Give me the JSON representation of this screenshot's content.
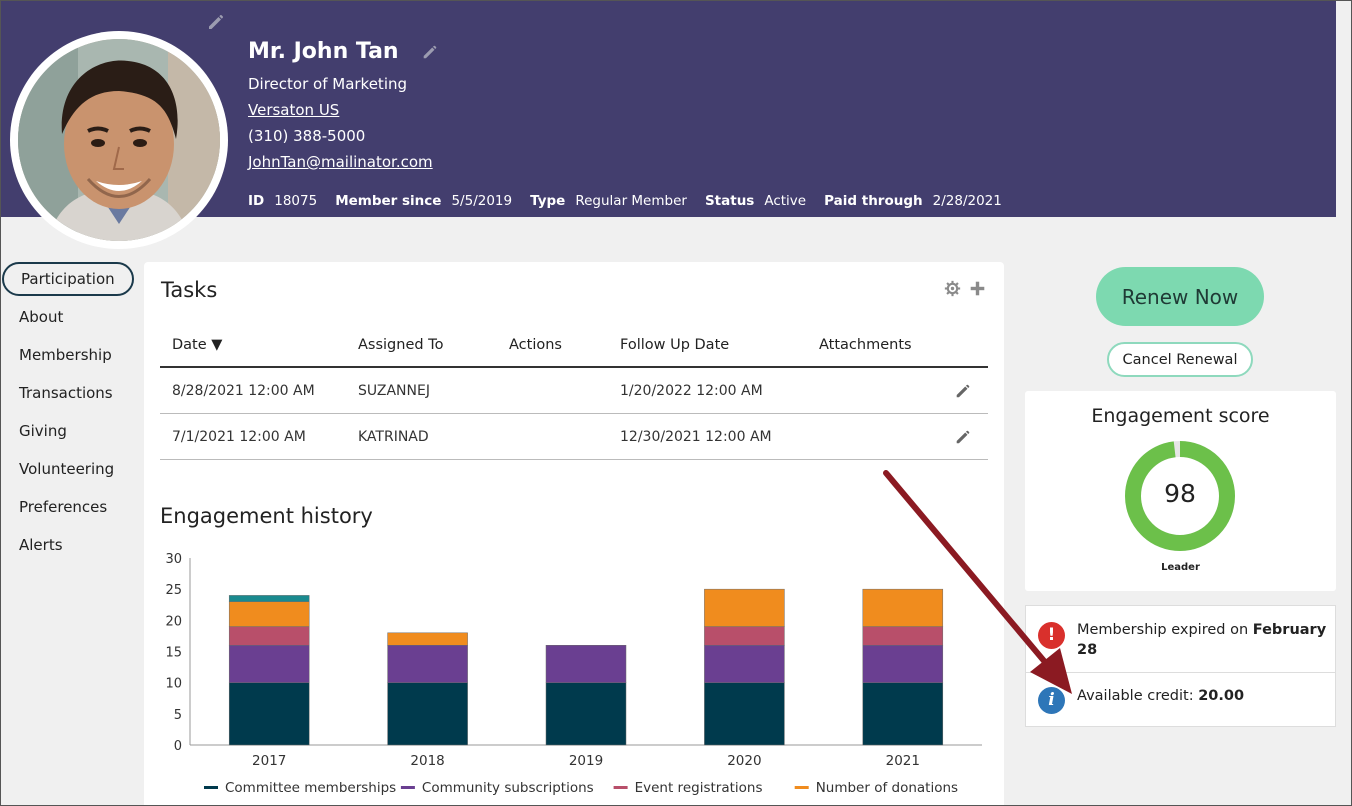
{
  "profile": {
    "name": "Mr. John Tan",
    "title": "Director of Marketing",
    "company": "Versaton US",
    "phone": "(310) 388-5000",
    "email": "JohnTan@mailinator.com",
    "meta": [
      {
        "key": "ID",
        "value": "18075"
      },
      {
        "key": "Member since",
        "value": "5/5/2019"
      },
      {
        "key": "Type",
        "value": "Regular Member"
      },
      {
        "key": "Status",
        "value": "Active"
      },
      {
        "key": "Paid through",
        "value": "2/28/2021"
      }
    ]
  },
  "nav": {
    "items": [
      {
        "label": "Participation",
        "active": true
      },
      {
        "label": "About"
      },
      {
        "label": "Membership"
      },
      {
        "label": "Transactions"
      },
      {
        "label": "Giving"
      },
      {
        "label": "Volunteering"
      },
      {
        "label": "Preferences"
      },
      {
        "label": "Alerts"
      }
    ]
  },
  "tasks": {
    "title": "Tasks",
    "columns": [
      "Date ▼",
      "Assigned To",
      "Actions",
      "Follow Up Date",
      "Attachments"
    ],
    "rows": [
      {
        "date": "8/28/2021 12:00 AM",
        "assigned": "SUZANNEJ",
        "actions": "",
        "followup": "1/20/2022 12:00 AM"
      },
      {
        "date": "7/1/2021 12:00 AM",
        "assigned": "KATRINAD",
        "actions": "",
        "followup": "12/30/2021 12:00 AM"
      }
    ]
  },
  "engagement_history": {
    "title": "Engagement history"
  },
  "chart_data": {
    "type": "bar",
    "stacked": true,
    "categories": [
      "2017",
      "2018",
      "2019",
      "2020",
      "2021"
    ],
    "series": [
      {
        "name": "Committee memberships",
        "color": "#003a4d",
        "values": [
          10,
          10,
          10,
          10,
          10
        ]
      },
      {
        "name": "Community subscriptions",
        "color": "#6a3f91",
        "values": [
          6,
          6,
          6,
          6,
          6
        ]
      },
      {
        "name": "Event registrations",
        "color": "#b84f6a",
        "values": [
          3,
          0,
          0,
          3,
          3
        ]
      },
      {
        "name": "Number of donations",
        "color": "#f08c1e",
        "values": [
          4,
          2,
          0,
          6,
          6
        ]
      },
      {
        "name": "",
        "color": "#1a8a8f",
        "values": [
          1,
          0,
          0,
          0,
          0
        ]
      }
    ],
    "ylim": [
      0,
      30
    ],
    "yticks": [
      0,
      5,
      10,
      15,
      20,
      25,
      30
    ],
    "legend_position": "bottom",
    "grid": false
  },
  "actions": {
    "renew_label": "Renew Now",
    "cancel_label": "Cancel Renewal"
  },
  "engagement_score": {
    "title": "Engagement score",
    "value": "98",
    "fraction": 0.98,
    "level": "Leader",
    "ring_color": "#6cc04a"
  },
  "alerts": {
    "expired_prefix": "Membership expired on ",
    "expired_date": "February 28",
    "credit_label": "Available credit: ",
    "credit_value": "20.00"
  },
  "colors": {
    "header_bg": "#433e6e",
    "accent_green": "#7dd9b0",
    "error_red": "#d9302c",
    "info_blue": "#2e76b8",
    "arrow": "#8b1a22"
  }
}
